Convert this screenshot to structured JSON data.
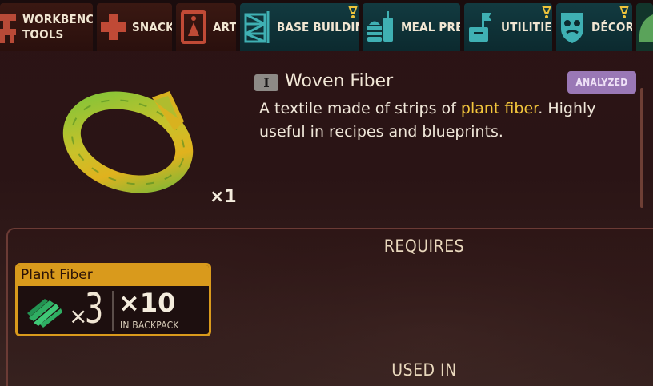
{
  "tabs": [
    {
      "label_line1": "WORKBENCH",
      "label_line2": "TOOLS",
      "icon": "workbench-tools-icon",
      "has_alert": false
    },
    {
      "label": "SNACKS",
      "icon": "medical-cross-icon",
      "has_alert": false
    },
    {
      "label": "ART",
      "icon": "easel-icon",
      "has_alert": false
    },
    {
      "label": "BASE BUILDING",
      "icon": "scaffold-icon",
      "has_alert": true
    },
    {
      "label": "MEAL PREP",
      "icon": "food-icon",
      "has_alert": false
    },
    {
      "label": "UTILITIES",
      "icon": "mailbox-icon",
      "has_alert": true
    },
    {
      "label": "DÉCOR",
      "icon": "shield-face-icon",
      "has_alert": true
    },
    {
      "label": "",
      "icon": "leaf-icon",
      "has_alert": false
    }
  ],
  "item": {
    "tier": "I",
    "name": "Woven Fiber",
    "status": "ANALYZED",
    "description_pre": "A textile made of strips of ",
    "description_highlight": "plant fiber",
    "description_post": ". Highly useful in recipes and blueprints.",
    "quantity": "×1",
    "image": "woven-fiber-ring-icon"
  },
  "requires": {
    "heading": "REQUIRES",
    "ingredients": [
      {
        "name": "Plant Fiber",
        "icon": "plant-fiber-icon",
        "times": "×",
        "required": "3",
        "have": "×10",
        "location": "IN BACKPACK"
      }
    ]
  },
  "used_in": {
    "heading": "USED IN"
  },
  "colors": {
    "accent_gold": "#d99a1c",
    "highlight_text": "#f3c63c",
    "analyzed_badge": "#9a78b6",
    "warm_tab": "#3a1812",
    "cool_tab": "#123a40"
  }
}
